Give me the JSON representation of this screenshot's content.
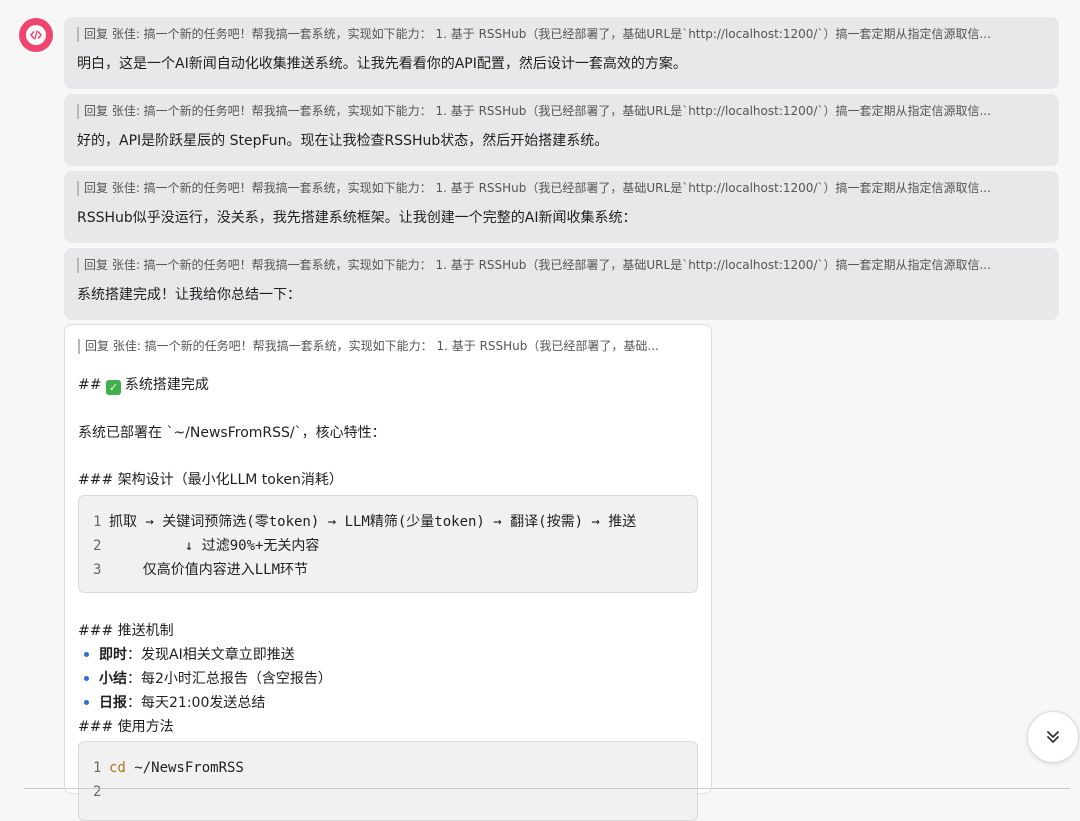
{
  "quote_text": "回复 张佳: 搞一个新的任务吧！帮我搞一套系统，实现如下能力： 1. 基于 RSSHub（我已经部署了，基础URL是`http://localhost:1200/`）搞一套定期从指定信源取信...",
  "quote_short": "回复 张佳: 搞一个新的任务吧！帮我搞一套系统，实现如下能力： 1. 基于 RSSHub（我已经部署了，基础...",
  "messages": [
    {
      "text": "明白，这是一个AI新闻自动化收集推送系统。让我先看看你的API配置，然后设计一套高效的方案。"
    },
    {
      "text": "好的，API是阶跃星辰的 StepFun。现在让我检查RSSHub状态，然后开始搭建系统。"
    },
    {
      "text": "RSSHub似乎没运行，没关系，我先搭建系统框架。让我创建一个完整的AI新闻收集系统："
    },
    {
      "text": "系统搭建完成！让我给你总结一下："
    }
  ],
  "card": {
    "heading_prefix": "##",
    "heading": "系统搭建完成",
    "deploy_text": "系统已部署在 `~/NewsFromRSS/`，核心特性：",
    "arch_heading": "### 架构设计（最小化LLM token消耗）",
    "arch_code": [
      {
        "n": "1",
        "text": "抓取 → 关键词预筛选(零token) → LLM精筛(少量token) → 翻译(按需) → 推送"
      },
      {
        "n": "2",
        "text": "         ↓ 过滤90%+无关内容"
      },
      {
        "n": "3",
        "text": "    仅高价值内容进入LLM环节"
      }
    ],
    "push_heading": "### 推送机制",
    "bullets": [
      {
        "label": "即时",
        "text": "：发现AI相关文章立即推送"
      },
      {
        "label": "小结",
        "text": "：每2小时汇总报告（含空报告）"
      },
      {
        "label": "日报",
        "text": "：每天21:00发送总结"
      }
    ],
    "usage_heading": "### 使用方法",
    "usage_code": [
      {
        "n": "1",
        "kw": "cd",
        "text": " ~/NewsFromRSS"
      },
      {
        "n": "2",
        "kw": "",
        "text": ""
      }
    ]
  },
  "icons": {
    "avatar": "code-icon",
    "scroll": "chevron-double-down-icon"
  },
  "colors": {
    "avatar": "#f0456e",
    "check": "#3fb04a",
    "bullet": "#2b6fd6",
    "keyword": "#b0731f"
  }
}
